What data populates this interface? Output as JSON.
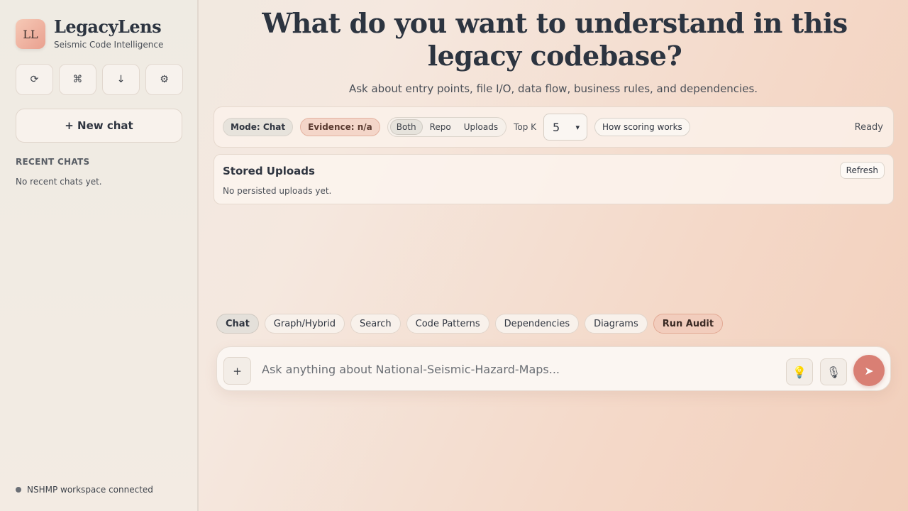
{
  "sidebar": {
    "logo_text": "LL",
    "app_name": "LegacyLens",
    "tagline": "Seismic Code Intelligence",
    "icon_buttons": [
      {
        "icon": "refresh-icon",
        "glyph": "⟳"
      },
      {
        "icon": "command-icon",
        "glyph": "⌘"
      },
      {
        "icon": "download-icon",
        "glyph": "↓"
      },
      {
        "icon": "gear-icon",
        "glyph": "⚙"
      }
    ],
    "new_chat_label": "+ New chat",
    "recent_heading": "RECENT CHATS",
    "recent_empty": "No recent chats yet.",
    "status_text": "NSHMP workspace connected"
  },
  "main": {
    "headline_line1": "What do you want to understand in this",
    "headline_line2": "legacy codebase?",
    "subheading": "Ask about entry points, file I/O, data flow, business rules, and dependencies."
  },
  "toolbar": {
    "mode_label": "Mode: Chat",
    "evidence_label": "Evidence: n/a",
    "sources": [
      "Both",
      "Repo",
      "Uploads"
    ],
    "active_source": "Both",
    "topk_label": "Top K",
    "topk_value": "5",
    "how_scoring_label": "How scoring works",
    "status": "Ready"
  },
  "uploads": {
    "title": "Stored Uploads",
    "empty_text": "No persisted uploads yet.",
    "refresh_label": "Refresh"
  },
  "modes": {
    "items": [
      "Chat",
      "Graph/Hybrid",
      "Search",
      "Code Patterns",
      "Dependencies",
      "Diagrams",
      "Run Audit"
    ],
    "active": "Chat"
  },
  "composer": {
    "attach_glyph": "+",
    "placeholder": "Ask anything about National-Seismic-Hazard-Maps...",
    "value": "",
    "bulb_glyph": "💡",
    "mic_glyph": "🎙",
    "send_glyph": "➤"
  },
  "colors": {
    "accent": "#d97f74",
    "evidence_bg": "#f4d6c9",
    "audit_bg": "#f2cdbd"
  }
}
